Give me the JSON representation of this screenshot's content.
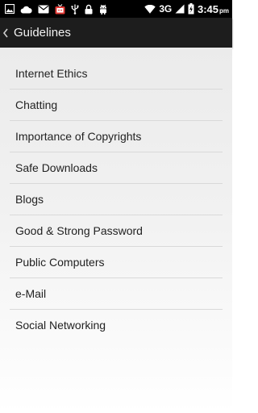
{
  "status_bar": {
    "left_icons": [
      "image-icon",
      "cloud-icon",
      "email-icon",
      "tv-app-icon",
      "usb-icon",
      "lock-icon",
      "android-icon"
    ],
    "right_icons": [
      "wifi-icon",
      "signal-icon",
      "battery-icon"
    ],
    "network_type": "3G",
    "time": "3:45",
    "ampm": "pm"
  },
  "action_bar": {
    "title": "Guidelines",
    "background": "#1d1d1d"
  },
  "guidelines": {
    "items": [
      {
        "label": "Internet Ethics"
      },
      {
        "label": "Chatting"
      },
      {
        "label": "Importance of Copyrights"
      },
      {
        "label": "Safe Downloads"
      },
      {
        "label": "Blogs"
      },
      {
        "label": "Good & Strong Password"
      },
      {
        "label": "Public Computers"
      },
      {
        "label": "e-Mail"
      },
      {
        "label": "Social Networking"
      }
    ]
  }
}
